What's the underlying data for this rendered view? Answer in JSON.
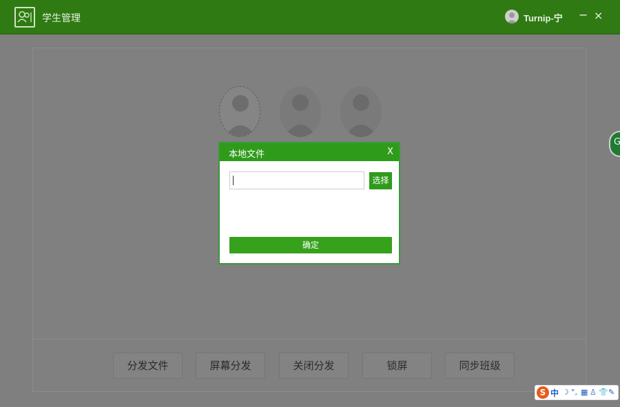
{
  "titlebar": {
    "app_title": "学生管理",
    "user_name": "Turnip-宁",
    "minimize_label": "−",
    "close_label": "×"
  },
  "modal": {
    "title": "本地文件",
    "close_label": "X",
    "file_value": "",
    "choose_label": "选择",
    "confirm_label": "确定"
  },
  "bottom_buttons": [
    {
      "label": "分发文件"
    },
    {
      "label": "屏幕分发"
    },
    {
      "label": "关闭分发"
    },
    {
      "label": "锁屏"
    },
    {
      "label": "同步班级"
    }
  ],
  "side_tab": {
    "label": "G"
  },
  "ime": {
    "logo": "S",
    "mode": "中",
    "tools": [
      "☽",
      "°,",
      "▦",
      "♙",
      "👕",
      "✎"
    ]
  },
  "colors": {
    "titlebar": "#2f7a13",
    "accent_green": "#2f9b1b",
    "overlay_gray": "#7f7f7f"
  },
  "icons": [
    "app-logo-icon",
    "user-avatar-icon",
    "student-avatar-icon",
    "ime-logo-icon"
  ]
}
